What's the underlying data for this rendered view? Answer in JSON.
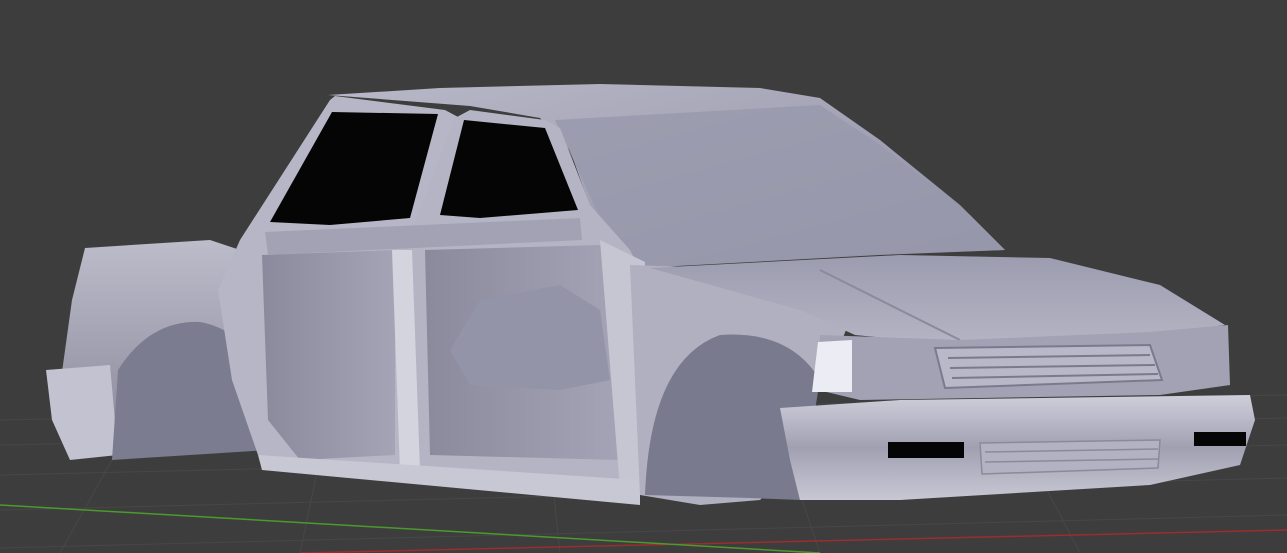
{
  "viewport": {
    "background_color": "#3d3d3d",
    "grid_line_color": "#4a4a4a",
    "x_axis_color": "#b03030",
    "y_axis_color": "#4c9a2a",
    "shading": "solid"
  },
  "model": {
    "kind": "car body shell (sedan, doors removed)",
    "material_color": "#a6a6b6",
    "highlight_color": "#e2e2ec",
    "shadow_color": "#6e6e80",
    "window_color": "#050505"
  }
}
